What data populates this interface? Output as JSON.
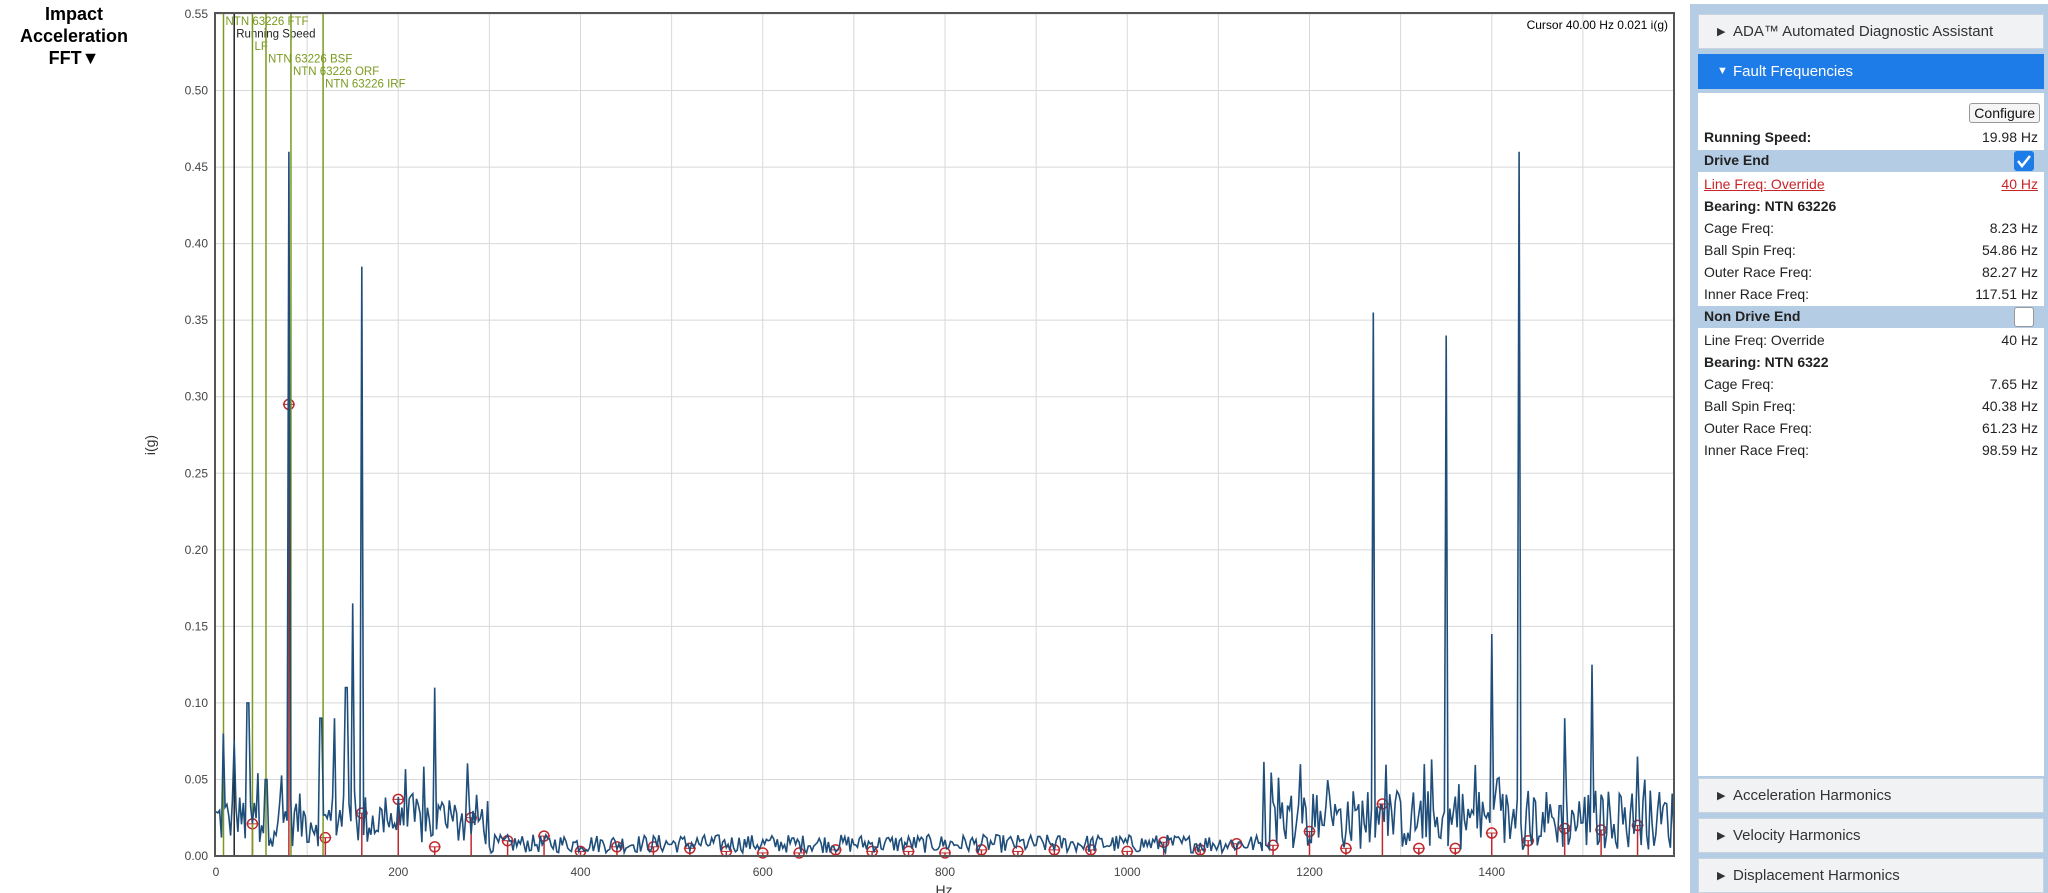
{
  "title": {
    "line1": "Impact",
    "line2": "Acceleration",
    "line3": "FFT▼"
  },
  "cursor_readout": "Cursor 40.00 Hz 0.021 i(g)",
  "colors": {
    "trace": "#1f4e7a",
    "marker": "#c0282d",
    "bearing": "#7a9a1e",
    "accent": "#1e7ce8",
    "panel": "#b5cde4"
  },
  "panel": {
    "ada_label": "ADA™ Automated Diagnostic Assistant",
    "fault_label": "Fault Frequencies",
    "configure_label": "Configure",
    "running_speed": {
      "label": "Running Speed:",
      "value": "19.98 Hz"
    },
    "drive_end": {
      "label": "Drive End",
      "checked": true,
      "line_freq": {
        "label": "Line Freq: Override",
        "value": "40 Hz"
      },
      "bearing": "Bearing: NTN 63226",
      "rows": [
        {
          "label": "Cage Freq:",
          "value": "8.23 Hz"
        },
        {
          "label": "Ball Spin Freq:",
          "value": "54.86 Hz"
        },
        {
          "label": "Outer Race Freq:",
          "value": "82.27 Hz"
        },
        {
          "label": "Inner Race Freq:",
          "value": "117.51 Hz"
        }
      ]
    },
    "non_drive_end": {
      "label": "Non Drive End",
      "checked": false,
      "line_freq": {
        "label": "Line Freq: Override",
        "value": "40 Hz"
      },
      "bearing": "Bearing: NTN 6322",
      "rows": [
        {
          "label": "Cage Freq:",
          "value": "7.65 Hz"
        },
        {
          "label": "Ball Spin Freq:",
          "value": "40.38 Hz"
        },
        {
          "label": "Outer Race Freq:",
          "value": "61.23 Hz"
        },
        {
          "label": "Inner Race Freq:",
          "value": "98.59 Hz"
        }
      ]
    },
    "accel_label": "Acceleration Harmonics",
    "vel_label": "Velocity Harmonics",
    "disp_label": "Displacement Harmonics"
  },
  "chart_data": {
    "type": "line",
    "xlabel": "Hz",
    "ylabel": "i(g)",
    "xlim": [
      0,
      1600
    ],
    "ylim": [
      0,
      0.55
    ],
    "x_ticks": [
      0,
      200,
      400,
      600,
      800,
      1000,
      1200,
      1400
    ],
    "y_ticks": [
      "0.00",
      "0.05",
      "0.10",
      "0.15",
      "0.20",
      "0.25",
      "0.30",
      "0.35",
      "0.40",
      "0.45",
      "0.50",
      "0.55"
    ],
    "grid": true,
    "series": [
      {
        "peaks": [
          {
            "x": 8,
            "y": 0.08
          },
          {
            "x": 20,
            "y": 0.075
          },
          {
            "x": 35,
            "y": 0.1
          },
          {
            "x": 55,
            "y": 0.05
          },
          {
            "x": 80,
            "y": 0.46
          },
          {
            "x": 115,
            "y": 0.09
          },
          {
            "x": 130,
            "y": 0.09
          },
          {
            "x": 143,
            "y": 0.11
          },
          {
            "x": 150,
            "y": 0.165
          },
          {
            "x": 160,
            "y": 0.385
          },
          {
            "x": 240,
            "y": 0.11
          },
          {
            "x": 1190,
            "y": 0.06
          },
          {
            "x": 1270,
            "y": 0.355
          },
          {
            "x": 1350,
            "y": 0.34
          },
          {
            "x": 1400,
            "y": 0.145
          },
          {
            "x": 1430,
            "y": 0.46
          },
          {
            "x": 1480,
            "y": 0.09
          },
          {
            "x": 1510,
            "y": 0.125
          },
          {
            "x": 1560,
            "y": 0.065
          }
        ]
      }
    ],
    "markers": [
      {
        "x": 40,
        "y": 0.021
      },
      {
        "x": 80,
        "y": 0.295
      },
      {
        "x": 120,
        "y": 0.012
      },
      {
        "x": 160,
        "y": 0.028
      },
      {
        "x": 200,
        "y": 0.037
      },
      {
        "x": 240,
        "y": 0.006
      },
      {
        "x": 280,
        "y": 0.025
      },
      {
        "x": 320,
        "y": 0.01
      },
      {
        "x": 360,
        "y": 0.013
      },
      {
        "x": 400,
        "y": 0.003
      },
      {
        "x": 440,
        "y": 0.006
      },
      {
        "x": 480,
        "y": 0.006
      },
      {
        "x": 520,
        "y": 0.005
      },
      {
        "x": 560,
        "y": 0.003
      },
      {
        "x": 600,
        "y": 0.002
      },
      {
        "x": 640,
        "y": 0.002
      },
      {
        "x": 680,
        "y": 0.004
      },
      {
        "x": 720,
        "y": 0.003
      },
      {
        "x": 760,
        "y": 0.003
      },
      {
        "x": 800,
        "y": 0.002
      },
      {
        "x": 840,
        "y": 0.004
      },
      {
        "x": 880,
        "y": 0.003
      },
      {
        "x": 920,
        "y": 0.004
      },
      {
        "x": 960,
        "y": 0.004
      },
      {
        "x": 1000,
        "y": 0.003
      },
      {
        "x": 1040,
        "y": 0.009
      },
      {
        "x": 1080,
        "y": 0.004
      },
      {
        "x": 1120,
        "y": 0.008
      },
      {
        "x": 1160,
        "y": 0.007
      },
      {
        "x": 1200,
        "y": 0.016
      },
      {
        "x": 1240,
        "y": 0.005
      },
      {
        "x": 1280,
        "y": 0.034
      },
      {
        "x": 1320,
        "y": 0.005
      },
      {
        "x": 1360,
        "y": 0.005
      },
      {
        "x": 1400,
        "y": 0.015
      },
      {
        "x": 1440,
        "y": 0.01
      },
      {
        "x": 1480,
        "y": 0.018
      },
      {
        "x": 1520,
        "y": 0.017
      },
      {
        "x": 1560,
        "y": 0.02
      }
    ],
    "fault_lines": [
      {
        "label": "NTN 63226 FTF",
        "x": 8.23,
        "color": "#7a9a1e",
        "level": 0
      },
      {
        "label": "Running Speed",
        "x": 19.98,
        "color": "#222222",
        "level": 1
      },
      {
        "label": "LF",
        "x": 40,
        "color": "#7a9a1e",
        "level": 2
      },
      {
        "label": "NTN 63226 BSF",
        "x": 54.86,
        "color": "#7a9a1e",
        "level": 3
      },
      {
        "label": "NTN 63226 ORF",
        "x": 82.27,
        "color": "#7a9a1e",
        "level": 4
      },
      {
        "label": "NTN 63226 IRF",
        "x": 117.51,
        "color": "#7a9a1e",
        "level": 5
      }
    ]
  }
}
